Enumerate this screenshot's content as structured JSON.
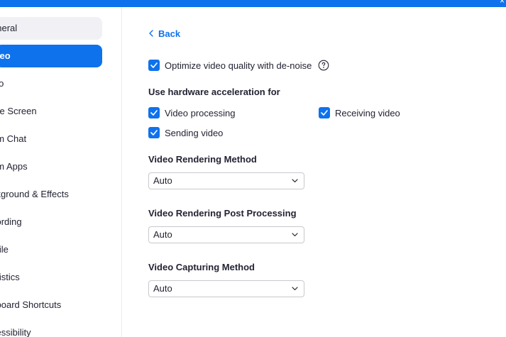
{
  "sidebar": {
    "items": [
      {
        "label": "eneral",
        "state": "hover"
      },
      {
        "label": "ideo",
        "state": "active"
      },
      {
        "label": "dio",
        "state": "normal"
      },
      {
        "label": "are Screen",
        "state": "normal"
      },
      {
        "label": "am Chat",
        "state": "normal"
      },
      {
        "label": "om Apps",
        "state": "normal"
      },
      {
        "label": "ckground & Effects",
        "state": "normal"
      },
      {
        "label": "cording",
        "state": "normal"
      },
      {
        "label": "ofile",
        "state": "normal"
      },
      {
        "label": "atistics",
        "state": "normal"
      },
      {
        "label": "yboard Shortcuts",
        "state": "normal"
      },
      {
        "label": "cessibility",
        "state": "normal"
      }
    ]
  },
  "main": {
    "back_label": "Back",
    "denoise": {
      "label": "Optimize video quality with de-noise",
      "checked": true
    },
    "hw_heading": "Use hardware acceleration for",
    "hw_options": {
      "video_processing": {
        "label": "Video processing",
        "checked": true
      },
      "receiving_video": {
        "label": "Receiving video",
        "checked": true
      },
      "sending_video": {
        "label": "Sending video",
        "checked": true
      }
    },
    "rendering_method": {
      "heading": "Video Rendering Method",
      "value": "Auto"
    },
    "post_processing": {
      "heading": "Video Rendering Post Processing",
      "value": "Auto"
    },
    "capturing_method": {
      "heading": "Video Capturing Method",
      "value": "Auto"
    }
  },
  "colors": {
    "accent": "#0e72ed",
    "hover": "#f1f1f5",
    "text": "#232333"
  }
}
